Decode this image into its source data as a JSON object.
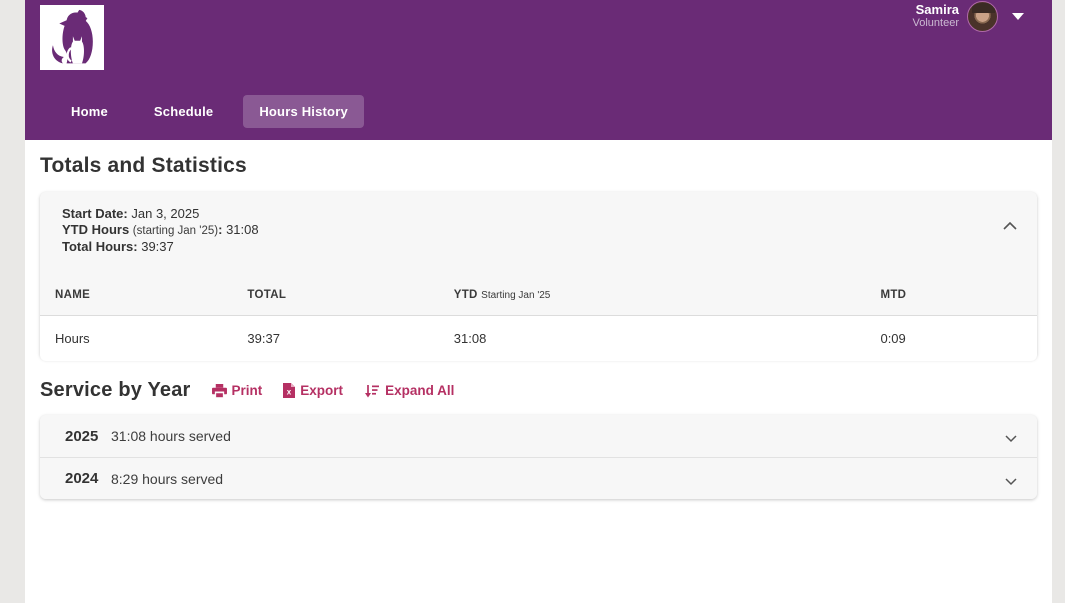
{
  "colors": {
    "header_purple": "#6a2b76",
    "accent_pink": "#b53063",
    "card_gray": "#f7f7f7",
    "chrome_gray": "#e9e8e6"
  },
  "header": {
    "logo": "dog-and-cat-silhouette",
    "user": {
      "name": "Samira",
      "role": "Volunteer"
    },
    "nav": [
      {
        "label": "Home",
        "active": false
      },
      {
        "label": "Schedule",
        "active": false
      },
      {
        "label": "Hours History",
        "active": true
      }
    ]
  },
  "totals": {
    "title": "Totals and Statistics",
    "stats": {
      "start_date_label": "Start Date:",
      "start_date_value": "Jan 3, 2025",
      "ytd_label": "YTD Hours",
      "ytd_note": "(starting Jan '25)",
      "ytd_colon": ":",
      "ytd_value": "31:08",
      "total_label": "Total Hours:",
      "total_value": "39:37"
    },
    "table": {
      "headers": [
        {
          "label": "NAME",
          "note": ""
        },
        {
          "label": "TOTAL",
          "note": ""
        },
        {
          "label": "YTD",
          "note": "Starting Jan '25"
        },
        {
          "label": "MTD",
          "note": ""
        }
      ],
      "rows": [
        {
          "cells": [
            "Hours",
            "39:37",
            "31:08",
            "0:09"
          ]
        }
      ]
    }
  },
  "service": {
    "title": "Service by Year",
    "actions": {
      "print": "Print",
      "export": "Export",
      "expand_all": "Expand All"
    },
    "years": [
      {
        "year": "2025",
        "summary": "31:08 hours served"
      },
      {
        "year": "2024",
        "summary": "8:29 hours served"
      }
    ]
  }
}
